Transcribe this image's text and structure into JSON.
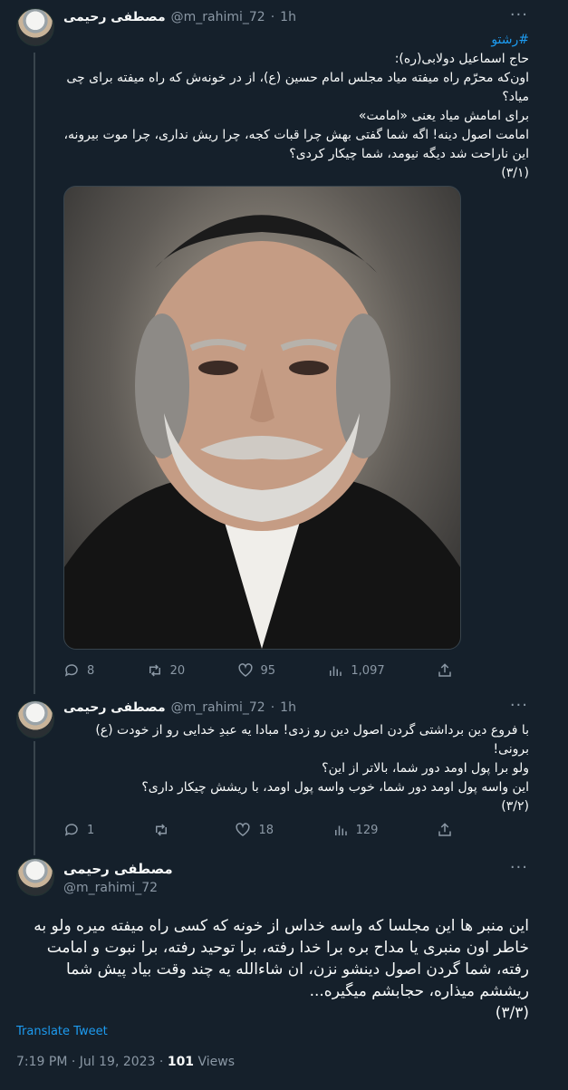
{
  "thread": [
    {
      "author": {
        "name": "مصطفی رحیمی",
        "handle": "@m_rahimi_72",
        "sep": "·",
        "time": "1h"
      },
      "hashtag": "#رشتو",
      "lines": [
        "حاج اسماعیل دولابی(ره):",
        "اون‌که محرّم راه میفته میاد مجلس امام حسین (ع)، از در خونه‌ش که راه میفته برای چی میاد؟",
        "برای امامش میاد یعنی «امامت»",
        "امامت اصول دینه! اگه شما گفتی بهش چرا قبات کجه، چرا ریش نداری، چرا موت بیرونه، این ناراحت شد دیگه نیومد، شما چیکار کردی؟",
        "(۳/۱)"
      ],
      "stats": {
        "replies": "8",
        "retweets": "20",
        "likes": "95",
        "views": "1,097"
      }
    },
    {
      "author": {
        "name": "مصطفی رحیمی",
        "handle": "@m_rahimi_72",
        "sep": "·",
        "time": "1h"
      },
      "lines": [
        "با فروع دین برداشتی گردن اصول دین رو زدی! مبادا یه عبدِ خدایی رو از خودت (ع) برونی!",
        "ولو برا پول اومد دور شما، بالاتر از این؟",
        "این واسه پول اومد دور شما، خوب واسه پول اومد، با ریشش چیکار داری؟",
        "(۳/۲)"
      ],
      "stats": {
        "replies": "1",
        "retweets": "",
        "likes": "18",
        "views": "129"
      }
    }
  ],
  "main": {
    "author": {
      "name": "مصطفی رحیمی",
      "handle": "@m_rahimi_72"
    },
    "lines": [
      "این منبر ها این مجلسا که واسه خداس از خونه که کسی راه میفته میره ولو به خاطر اون منبری یا مداح بره برا خدا رفته، برا توحید رفته، برا نبوت و امامت رفته، شما گردن اصول دینشو نزن، ان شاءالله یه چند وقت بیاد پیش شما ریششم میذاره، حجابشم میگیره...",
      "(۳/۳)"
    ],
    "translate": "Translate Tweet",
    "time": "7:19 PM",
    "date": "Jul 19, 2023",
    "views_count": "101",
    "views_label": "Views",
    "sep": "·"
  },
  "icons": {
    "more": "more-dots-icon",
    "reply": "reply-icon",
    "retweet": "retweet-icon",
    "like": "heart-icon",
    "views": "views-chart-icon",
    "share": "share-icon"
  },
  "colors": {
    "background": "#15202b",
    "accent": "#1d9bf0",
    "muted": "#8b98a5",
    "text": "#f7f9f9"
  }
}
